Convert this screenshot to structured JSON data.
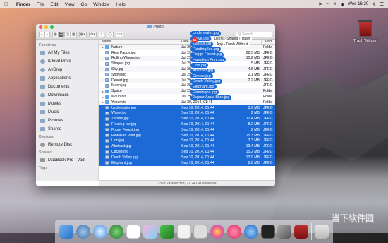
{
  "menubar": {
    "app": "Finder",
    "items": [
      "File",
      "Edit",
      "View",
      "Go",
      "Window",
      "Help"
    ],
    "clock": "Wed 16:20"
  },
  "desktop": {
    "icon_label": "Trash Without"
  },
  "window": {
    "title": "Photo",
    "search_placeholder": "Search"
  },
  "sidebar": {
    "favorites_heading": "Favorites",
    "favorites": [
      "All My Files",
      "iCloud Drive",
      "AirDrop",
      "Applications",
      "Documents",
      "Downloads",
      "Movies",
      "Music",
      "Pictures",
      "Shared"
    ],
    "devices_heading": "Devices",
    "devices": [
      "Remote Disc"
    ],
    "shared_heading": "Shared",
    "shared": [
      "MacBook Pro - Vad"
    ],
    "tags_heading": "Tags"
  },
  "columns": {
    "name": "Name",
    "date": "Date M",
    "size": "",
    "kind": "Kind"
  },
  "files": [
    {
      "name": "Nature",
      "date": "Jul 29,",
      "size": "",
      "kind": "Folde",
      "type": "folder",
      "selected": false
    },
    {
      "name": "Rice Paddy.jpg",
      "date": "Jul 29,",
      "size": "22.5 MB",
      "kind": "JPEG",
      "type": "img",
      "selected": false
    },
    {
      "name": "Rolling Waves.jpg",
      "date": "Jul 29,",
      "size": "10.2 MB",
      "kind": "JPEG",
      "type": "img",
      "selected": false
    },
    {
      "name": "Shapes.jpg",
      "date": "Jul 29,",
      "size": "5 MB",
      "kind": "JPEG",
      "type": "img",
      "selected": false
    },
    {
      "name": "Sky.jpg",
      "date": "Jul 29,",
      "size": "4.6 MB",
      "kind": "JPEG",
      "type": "img",
      "selected": false
    },
    {
      "name": "Snow.jpg",
      "date": "Jul 29,",
      "size": "2.1 MB",
      "kind": "JPEG",
      "type": "img",
      "selected": false
    },
    {
      "name": "Desert.jpg",
      "date": "Jul 29,",
      "size": "2.2 MB",
      "kind": "JPEG",
      "type": "img",
      "selected": false
    },
    {
      "name": "Moon.jpg",
      "date": "Jul 29,",
      "size": "",
      "kind": "JPEG",
      "type": "img",
      "selected": false
    },
    {
      "name": "Space",
      "date": "Jul 29,",
      "size": "",
      "kind": "Folde",
      "type": "folder",
      "selected": false
    },
    {
      "name": "Mountain",
      "date": "Jul 29,",
      "size": "",
      "kind": "Folde",
      "type": "folder",
      "selected": false
    },
    {
      "name": "Yosemite",
      "date": "Jul 29, 2014, 01:41",
      "size": "",
      "kind": "Folde",
      "type": "folder",
      "selected": false
    },
    {
      "name": "Underwater.jpg",
      "date": "Sep 10, 2014, 01:44",
      "size": "3.9 MB",
      "kind": "JPEG",
      "type": "img",
      "selected": true
    },
    {
      "name": "Wave.jpg",
      "date": "Sep 10, 2014, 01:44",
      "size": "2 MB",
      "kind": "JPEG",
      "type": "img",
      "selected": true
    },
    {
      "name": "Zebras.jpg",
      "date": "Sep 10, 2014, 01:44",
      "size": "11.4 MB",
      "kind": "JPEG",
      "type": "img",
      "selected": true
    },
    {
      "name": "Floating Ice.jpg",
      "date": "Sep 10, 2014, 01:44",
      "size": "8.2 MB",
      "kind": "JPEG",
      "type": "img",
      "selected": true
    },
    {
      "name": "Foggy Forest.jpg",
      "date": "Sep 10, 2014, 01:44",
      "size": "2 MB",
      "kind": "JPEG",
      "type": "img",
      "selected": true
    },
    {
      "name": "Hawaiian Print.jpg",
      "date": "Sep 10, 2014, 01:44",
      "size": "15.3 MB",
      "kind": "JPEG",
      "type": "img",
      "selected": true
    },
    {
      "name": "Lion.jpg",
      "date": "Sep 10, 2014, 01:44",
      "size": "3.3 MB",
      "kind": "JPEG",
      "type": "img",
      "selected": true
    },
    {
      "name": "Abstract.jpg",
      "date": "Sep 10, 2014, 01:44",
      "size": "13.4 MB",
      "kind": "JPEG",
      "type": "img",
      "selected": true
    },
    {
      "name": "Circles.jpg",
      "date": "Sep 10, 2014, 01:44",
      "size": "15.2 MB",
      "kind": "JPEG",
      "type": "img",
      "selected": true
    },
    {
      "name": "Death Valley.jpg",
      "date": "Sep 10, 2014, 01:44",
      "size": "13.9 MB",
      "kind": "JPEG",
      "type": "img",
      "selected": true
    },
    {
      "name": "Elephant.jpg",
      "date": "Sep 10, 2014, 01:44",
      "size": "8.8 MB",
      "kind": "JPEG",
      "type": "img",
      "selected": true
    }
  ],
  "status": "13 of 24 selected, 27.24 GB available",
  "drag": {
    "badge_count": "11",
    "items": [
      "Underwater.jpg",
      "Wave.jpg",
      "Zebras.jpg",
      "Floating Ice.jpg",
      "Foggy Forest.jpg",
      "Hawaiian Print.jpg",
      "Lion.jpg",
      "Abstract.jpg",
      "Circles.jpg",
      "Death Valley.jpg",
      "Elephant.jpg",
      "Flamingos.jpg",
      "Jaguar Aqua Blue.jpg"
    ],
    "path_tip_1": "Users › Shared › Trash",
    "path_tip_2": "App › Trash Without"
  },
  "watermark": "当下软件园",
  "colors": {
    "selection": "#1c6ad6",
    "folder": "#5ea2e8"
  }
}
